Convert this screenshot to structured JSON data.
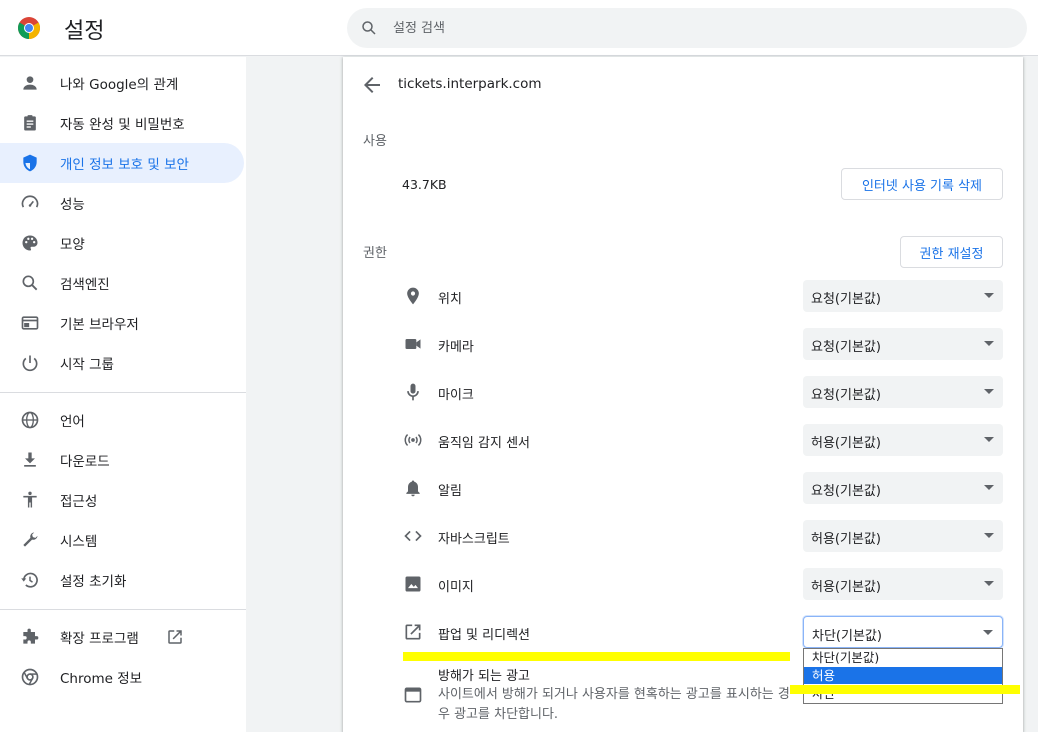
{
  "header": {
    "title": "설정",
    "search_placeholder": "설정 검색",
    "logo_icon": "chrome-logo-icon"
  },
  "sidebar": {
    "items": [
      {
        "label": "나와 Google의 관계",
        "icon": "person-icon"
      },
      {
        "label": "자동 완성 및 비밀번호",
        "icon": "clipboard-icon"
      },
      {
        "label": "개인 정보 보호 및 보안",
        "icon": "shield-icon",
        "active": true
      },
      {
        "label": "성능",
        "icon": "speedometer-icon"
      },
      {
        "label": "모양",
        "icon": "palette-icon"
      },
      {
        "label": "검색엔진",
        "icon": "search-icon"
      },
      {
        "label": "기본 브라우저",
        "icon": "browser-icon"
      },
      {
        "label": "시작 그룹",
        "icon": "power-icon"
      },
      {
        "label": "언어",
        "icon": "globe-icon"
      },
      {
        "label": "다운로드",
        "icon": "download-icon"
      },
      {
        "label": "접근성",
        "icon": "accessibility-icon"
      },
      {
        "label": "시스템",
        "icon": "wrench-icon"
      },
      {
        "label": "설정 초기화",
        "icon": "history-icon"
      },
      {
        "label": "확장 프로그램",
        "icon": "puzzle-icon"
      },
      {
        "label": "Chrome 정보",
        "icon": "chrome-icon"
      }
    ]
  },
  "main": {
    "site": "tickets.interpark.com",
    "usage_label": "사용",
    "usage_value": "43.7KB",
    "clear_button": "인터넷 사용 기록 삭제",
    "permissions_label": "권한",
    "reset_button": "권한 재설정",
    "permissions": [
      {
        "label": "위치",
        "value": "요청(기본값)",
        "icon": "location-pin-icon"
      },
      {
        "label": "카메라",
        "value": "요청(기본값)",
        "icon": "camera-icon"
      },
      {
        "label": "마이크",
        "value": "요청(기본값)",
        "icon": "microphone-icon"
      },
      {
        "label": "움직임 감지 센서",
        "value": "허용(기본값)",
        "icon": "sensors-icon"
      },
      {
        "label": "알림",
        "value": "요청(기본값)",
        "icon": "bell-icon"
      },
      {
        "label": "자바스크립트",
        "value": "허용(기본값)",
        "icon": "code-icon"
      },
      {
        "label": "이미지",
        "value": "허용(기본값)",
        "icon": "image-icon"
      },
      {
        "label": "팝업 및 리디렉션",
        "value": "차단(기본값)",
        "icon": "open-in-new-icon"
      }
    ],
    "ads": {
      "title": "방해가 되는 광고",
      "description": "사이트에서 방해가 되거나 사용자를 현혹하는 광고를 표시하는 경우 광고를 차단합니다.",
      "icon": "ad-window-icon"
    },
    "popup_dropdown": {
      "options": [
        "차단(기본값)",
        "허용",
        "차단"
      ],
      "highlighted_index": 1
    }
  },
  "colors": {
    "accent": "#1a73e8",
    "active_bg": "#e8f0fe",
    "highlight": "#ffff00"
  }
}
